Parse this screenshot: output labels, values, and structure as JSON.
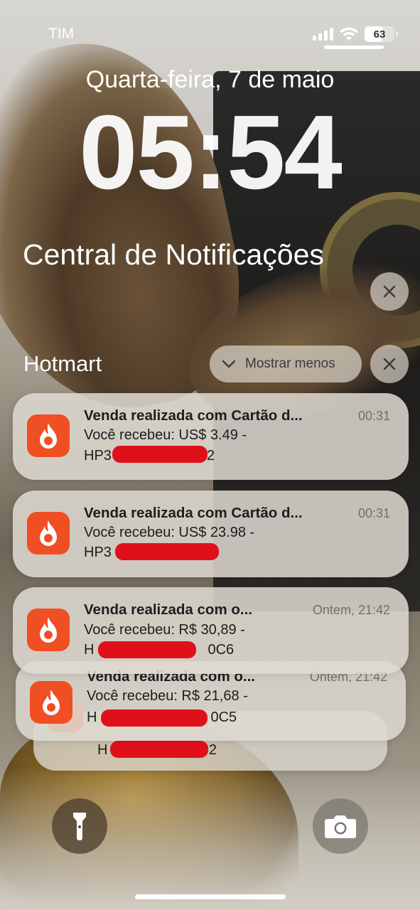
{
  "status_bar": {
    "carrier": "TIM",
    "battery_percent": "63",
    "battery_level": 0.63,
    "signal_icon": "cellular-signal-icon",
    "wifi_icon": "wifi-icon"
  },
  "lock_screen": {
    "date": "Quarta-feira, 7 de maio",
    "time": "05:54"
  },
  "notification_center": {
    "title": "Central de Notificações",
    "clear_icon": "close-icon"
  },
  "group": {
    "app_name": "Hotmart",
    "show_less_label": "Mostrar menos",
    "show_less_icon": "chevron-down-icon",
    "clear_icon": "close-icon"
  },
  "notifications": [
    {
      "title": "Venda realizada com Cartão d...",
      "time": "00:31",
      "body": "Você recebeu: US$ 3.49 -",
      "ref_visible": "HP3",
      "ref_suffix": "2"
    },
    {
      "title": "Venda realizada com Cartão d...",
      "time": "00:31",
      "body": "Você recebeu: US$ 23.98 -",
      "ref_visible": "HP3",
      "ref_suffix": ""
    },
    {
      "title": "Venda realizada com o...",
      "time": "Ontem, 21:42",
      "body": "Você recebeu: R$ 30,89 -",
      "ref_visible": "H",
      "ref_suffix": "0C6"
    },
    {
      "title": "Venda realizada com o...",
      "time": "Ontem, 21:42",
      "body": "Você recebeu: R$ 21,68 -",
      "ref_visible": "H",
      "ref_suffix": "0C5"
    },
    {
      "title": "",
      "time": "",
      "body": "",
      "ref_visible": "H",
      "ref_suffix": "C2"
    }
  ],
  "bottom_controls": {
    "left_icon": "flashlight-icon",
    "right_icon": "camera-icon"
  },
  "colors": {
    "hotmart_orange": "#f04e23",
    "redaction_red": "#e0101b"
  }
}
